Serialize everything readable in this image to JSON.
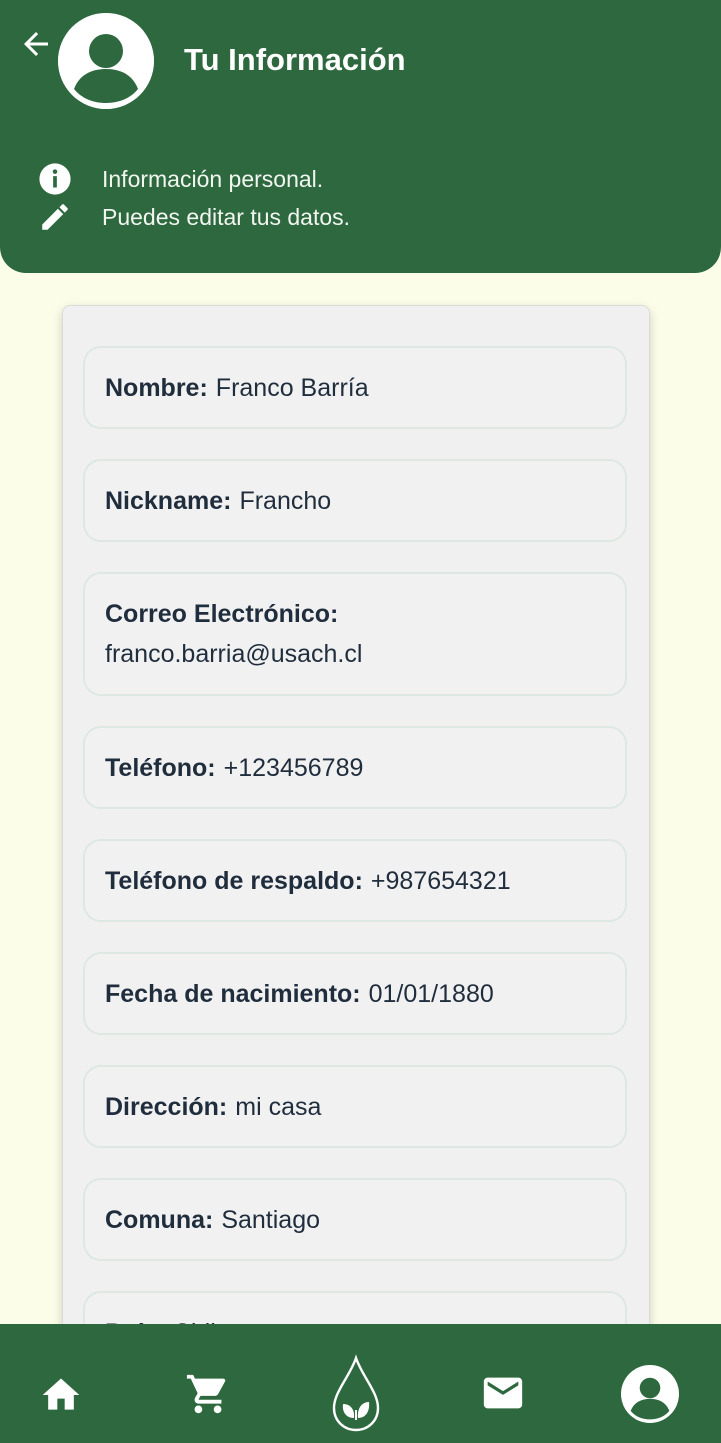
{
  "header": {
    "title": "Tu Información",
    "info_line_1": "Información personal.",
    "info_line_2": "Puedes editar tus datos.",
    "bg_color": "#2d683e"
  },
  "profile": {
    "fields": [
      {
        "label": "Nombre:",
        "value": "Franco Barría"
      },
      {
        "label": "Nickname:",
        "value": "Francho"
      },
      {
        "label": "Correo Electrónico:",
        "value": "franco.barria@usach.cl"
      },
      {
        "label": "Teléfono:",
        "value": "+123456789"
      },
      {
        "label": "Teléfono de respaldo:",
        "value": "+987654321"
      },
      {
        "label": "Fecha de nacimiento:",
        "value": "01/01/1880"
      },
      {
        "label": "Dirección:",
        "value": "mi casa"
      },
      {
        "label": "Comuna:",
        "value": "Santiago"
      },
      {
        "label": "País:",
        "value": "Chile"
      }
    ]
  },
  "bottom_nav": {
    "items": [
      "home-icon",
      "cart-icon",
      "leaf-drop-logo-icon",
      "mail-icon",
      "profile-icon"
    ]
  }
}
